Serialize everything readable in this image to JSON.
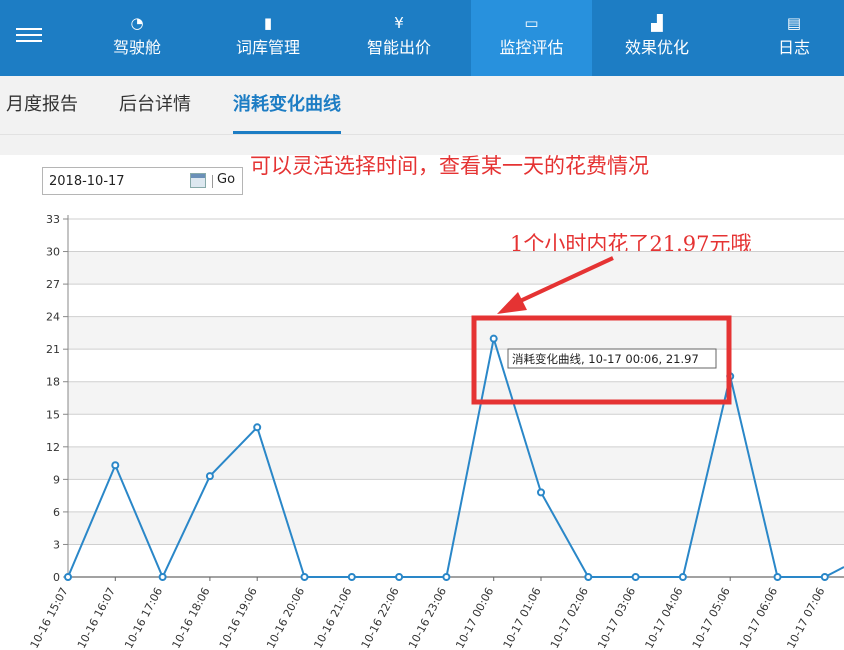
{
  "nav": {
    "items": [
      {
        "label": "驾驶舱",
        "icon": "gauge-icon",
        "glyph": "◔"
      },
      {
        "label": "词库管理",
        "icon": "bookmark-icon",
        "glyph": "▮"
      },
      {
        "label": "智能出价",
        "icon": "yen-icon",
        "glyph": "¥"
      },
      {
        "label": "监控评估",
        "icon": "monitor-icon",
        "glyph": "▭"
      },
      {
        "label": "效果优化",
        "icon": "signal-bars-icon",
        "glyph": "▟"
      },
      {
        "label": "日志",
        "icon": "clipboard-icon",
        "glyph": "▤"
      }
    ],
    "active_index": 3
  },
  "tabs": [
    {
      "label": "月度报告"
    },
    {
      "label": "后台详情"
    },
    {
      "label": "消耗变化曲线"
    }
  ],
  "date_picker": {
    "value": "2018-10-17",
    "go_label": "Go"
  },
  "annotations": {
    "top_note": "可以灵活选择时间，查看某一天的花费情况",
    "callout": "1个小时内花了21.97元哦"
  },
  "tooltip": {
    "text": "消耗变化曲线, 10-17 00:06, 21.97"
  },
  "colors": {
    "nav_bg": "#1d7dc4",
    "nav_active": "#2891dd",
    "series": "#2a87c8",
    "annotation": "#e53333"
  },
  "chart_data": {
    "type": "line",
    "series": [
      {
        "name": "消耗变化曲线"
      }
    ],
    "x": [
      "10-16 15:07",
      "10-16 16:07",
      "10-16 17:06",
      "10-16 18:06",
      "10-16 19:06",
      "10-16 20:06",
      "10-16 21:06",
      "10-16 22:06",
      "10-16 23:06",
      "10-17 00:06",
      "10-17 01:06",
      "10-17 02:06",
      "10-17 03:06",
      "10-17 04:06",
      "10-17 05:06",
      "10-17 06:06",
      "10-17 07:06"
    ],
    "values": [
      0,
      10.3,
      0,
      9.3,
      13.8,
      0,
      0,
      0,
      0,
      21.97,
      7.8,
      0,
      0,
      0,
      18.5,
      0,
      0
    ],
    "ylim": [
      0,
      33
    ],
    "yticks": [
      0,
      3,
      6,
      9,
      12,
      15,
      18,
      21,
      24,
      27,
      30,
      33
    ],
    "grid": true,
    "alternating_bands": true
  }
}
